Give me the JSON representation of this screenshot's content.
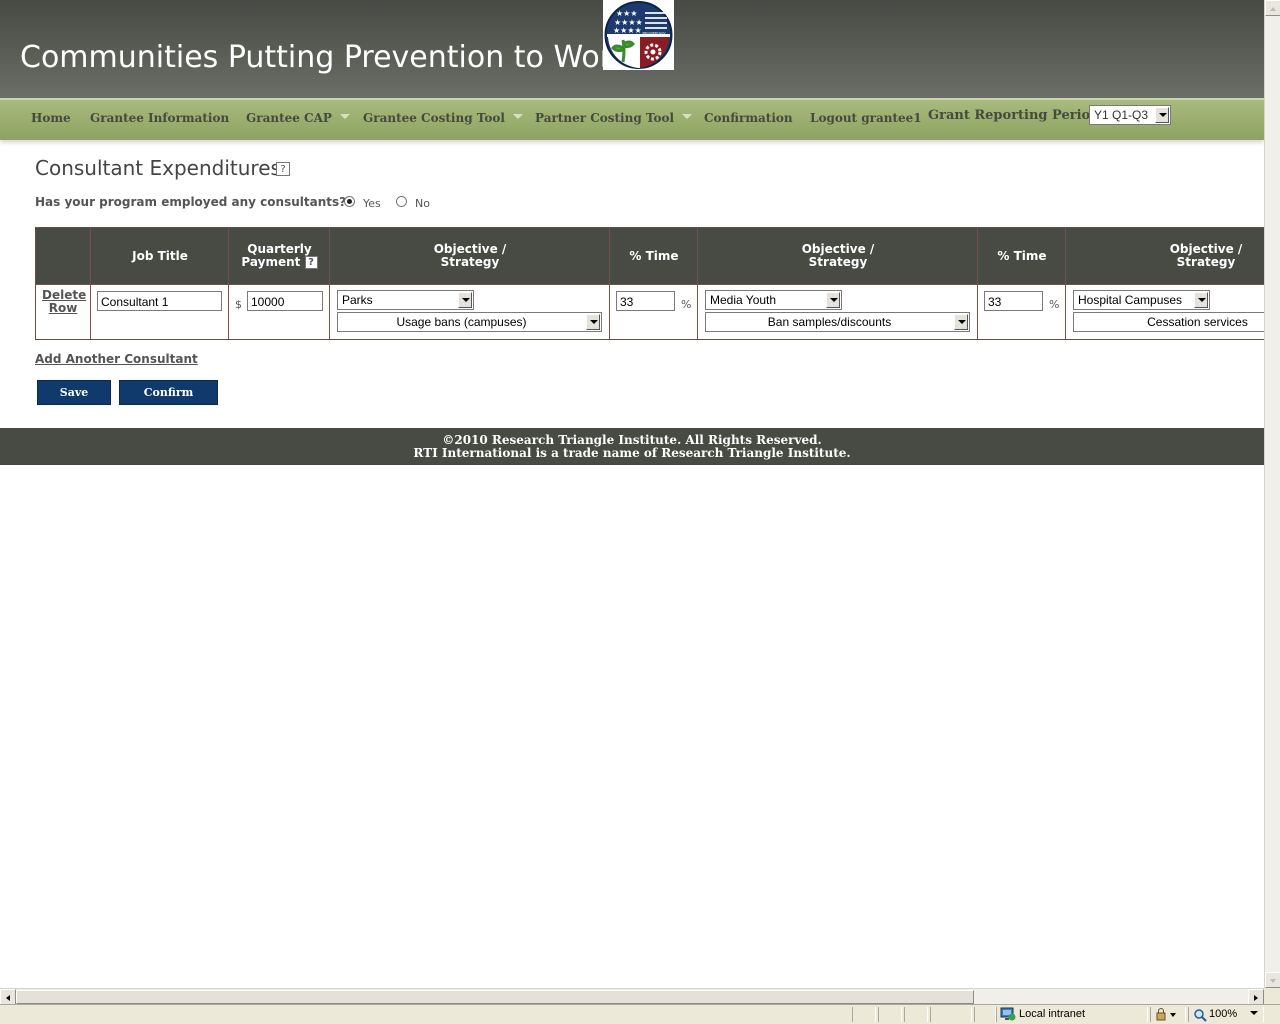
{
  "header": {
    "title": "Communities Putting Prevention to Work",
    "logo_text": "RECOVERY.GOV"
  },
  "nav": {
    "items": [
      {
        "label": "Home"
      },
      {
        "label": "Grantee Information"
      },
      {
        "label": "Grantee CAP"
      },
      {
        "label": "Grantee Costing Tool"
      },
      {
        "label": "Partner Costing Tool"
      },
      {
        "label": "Confirmation"
      },
      {
        "label": "Logout grantee1"
      }
    ],
    "period_label": "Grant Reporting Period:",
    "period_value": "Y1 Q1-Q3"
  },
  "page": {
    "title": "Consultant Expenditures",
    "help": "?",
    "question": "Has your program employed any consultants?",
    "yes_label": "Yes",
    "no_label": "No",
    "selected": "Yes"
  },
  "table": {
    "headers": {
      "job_title": "Job Title",
      "payment_line1": "Quarterly",
      "payment_line2": "Payment",
      "objective_line1": "Objective /",
      "objective_line2": "Strategy",
      "time": "% Time"
    },
    "rows": [
      {
        "delete_line1": "Delete",
        "delete_line2": "Row",
        "job_title": "Consultant 1",
        "currency": "$",
        "payment": "10000",
        "percent_sign": "%",
        "objectives": [
          {
            "objective": "Parks",
            "strategy": "Usage bans (campuses)",
            "time": "33"
          },
          {
            "objective": "Media Youth",
            "strategy": "Ban samples/discounts",
            "time": "33"
          },
          {
            "objective": "Hospital Campuses",
            "strategy": "Cessation services"
          }
        ]
      }
    ]
  },
  "actions": {
    "add_consultant": "Add Another Consultant",
    "save": "Save",
    "confirm": "Confirm"
  },
  "footer": {
    "line1": "©2010 Research Triangle Institute. All Rights Reserved.",
    "line2": "RTI International is a trade name of Research Triangle Institute."
  },
  "statusbar": {
    "zone": "Local intranet",
    "zoom": "100%"
  },
  "colors": {
    "header_bg": "#474944",
    "nav_bg": "#98ac6c",
    "table_header_bg": "#484a44",
    "button_bg": "#0f3a6b"
  }
}
